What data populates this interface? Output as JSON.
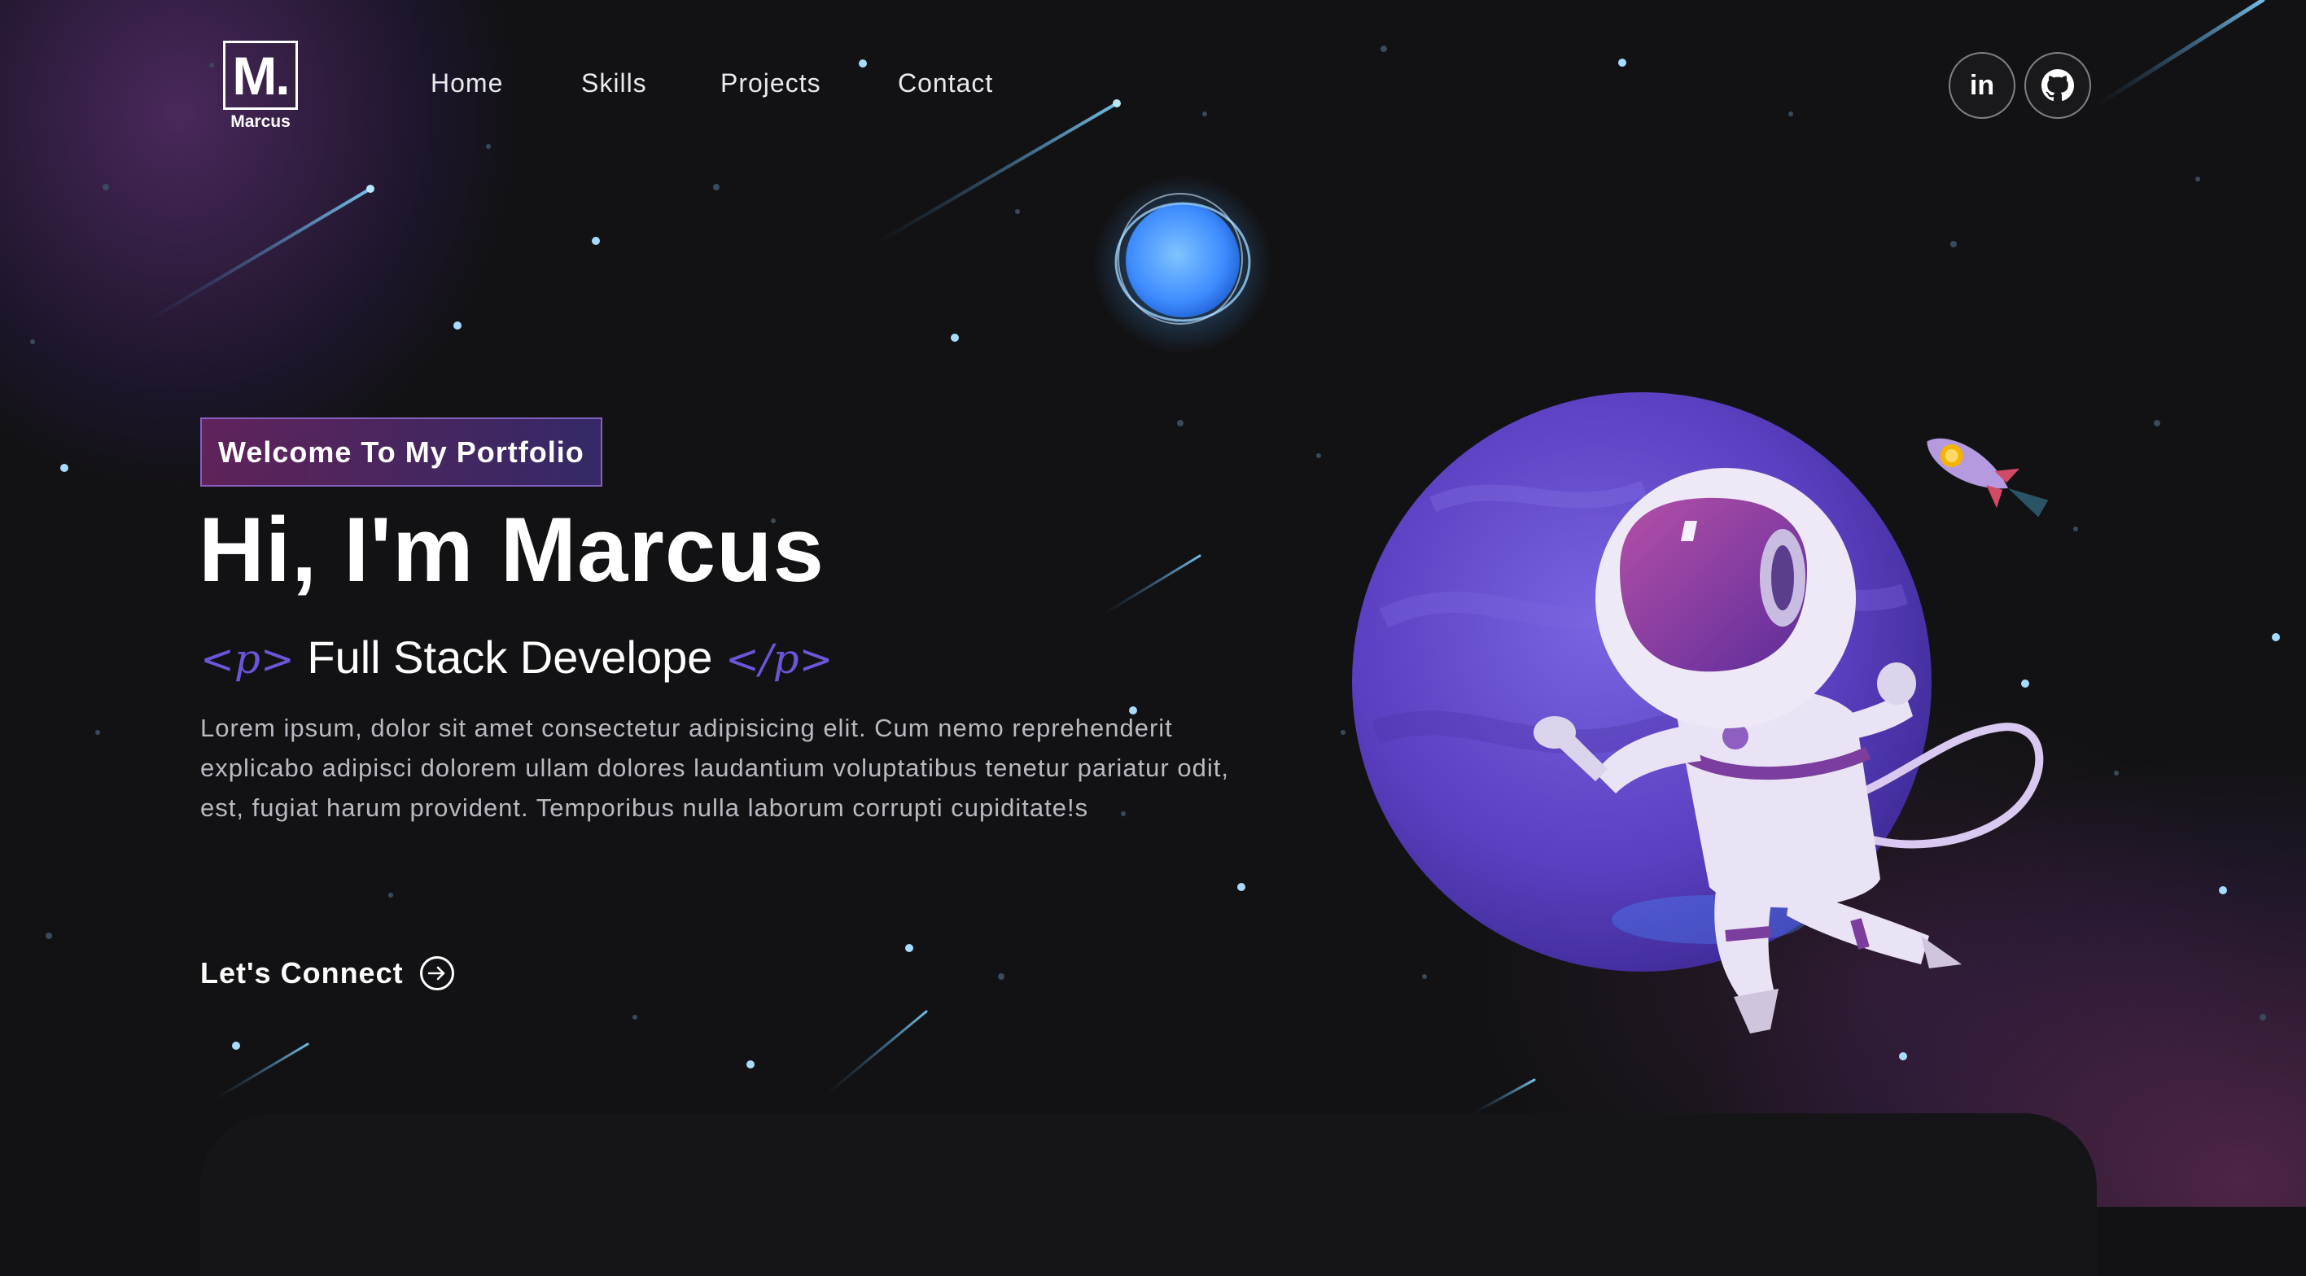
{
  "brand": {
    "logo_letter": "M.",
    "logo_name": "Marcus"
  },
  "nav": {
    "items": [
      "Home",
      "Skills",
      "Projects",
      "Contact"
    ]
  },
  "social": [
    {
      "name": "linkedin",
      "icon": "linkedin-icon",
      "label": "in"
    },
    {
      "name": "github",
      "icon": "github-icon"
    }
  ],
  "hero": {
    "tagline": "Welcome To My Portfolio",
    "headline": "Hi, I'm Marcus",
    "role_open_tag": "<p>",
    "role": "Full Stack Develope",
    "role_close_tag": "</p>",
    "bio": "Lorem ipsum, dolor sit amet consectetur adipisicing elit. Cum nemo reprehenderit explicabo adipisci dolorem ullam dolores laudantium voluptatibus tenetur pariatur odit, est, fugiat harum provident. Temporibus nulla laborum corrupti cupiditate!s",
    "cta": "Let's Connect"
  },
  "colors": {
    "background": "#121214",
    "accent_purple": "#6b55d8",
    "tagline_border": "#a078e6",
    "planet": "#6a4cc8",
    "star": "#9fd8ff"
  },
  "illustrations": [
    "blue-planet",
    "purple-planet",
    "astronaut",
    "rocket",
    "shooting-stars"
  ]
}
